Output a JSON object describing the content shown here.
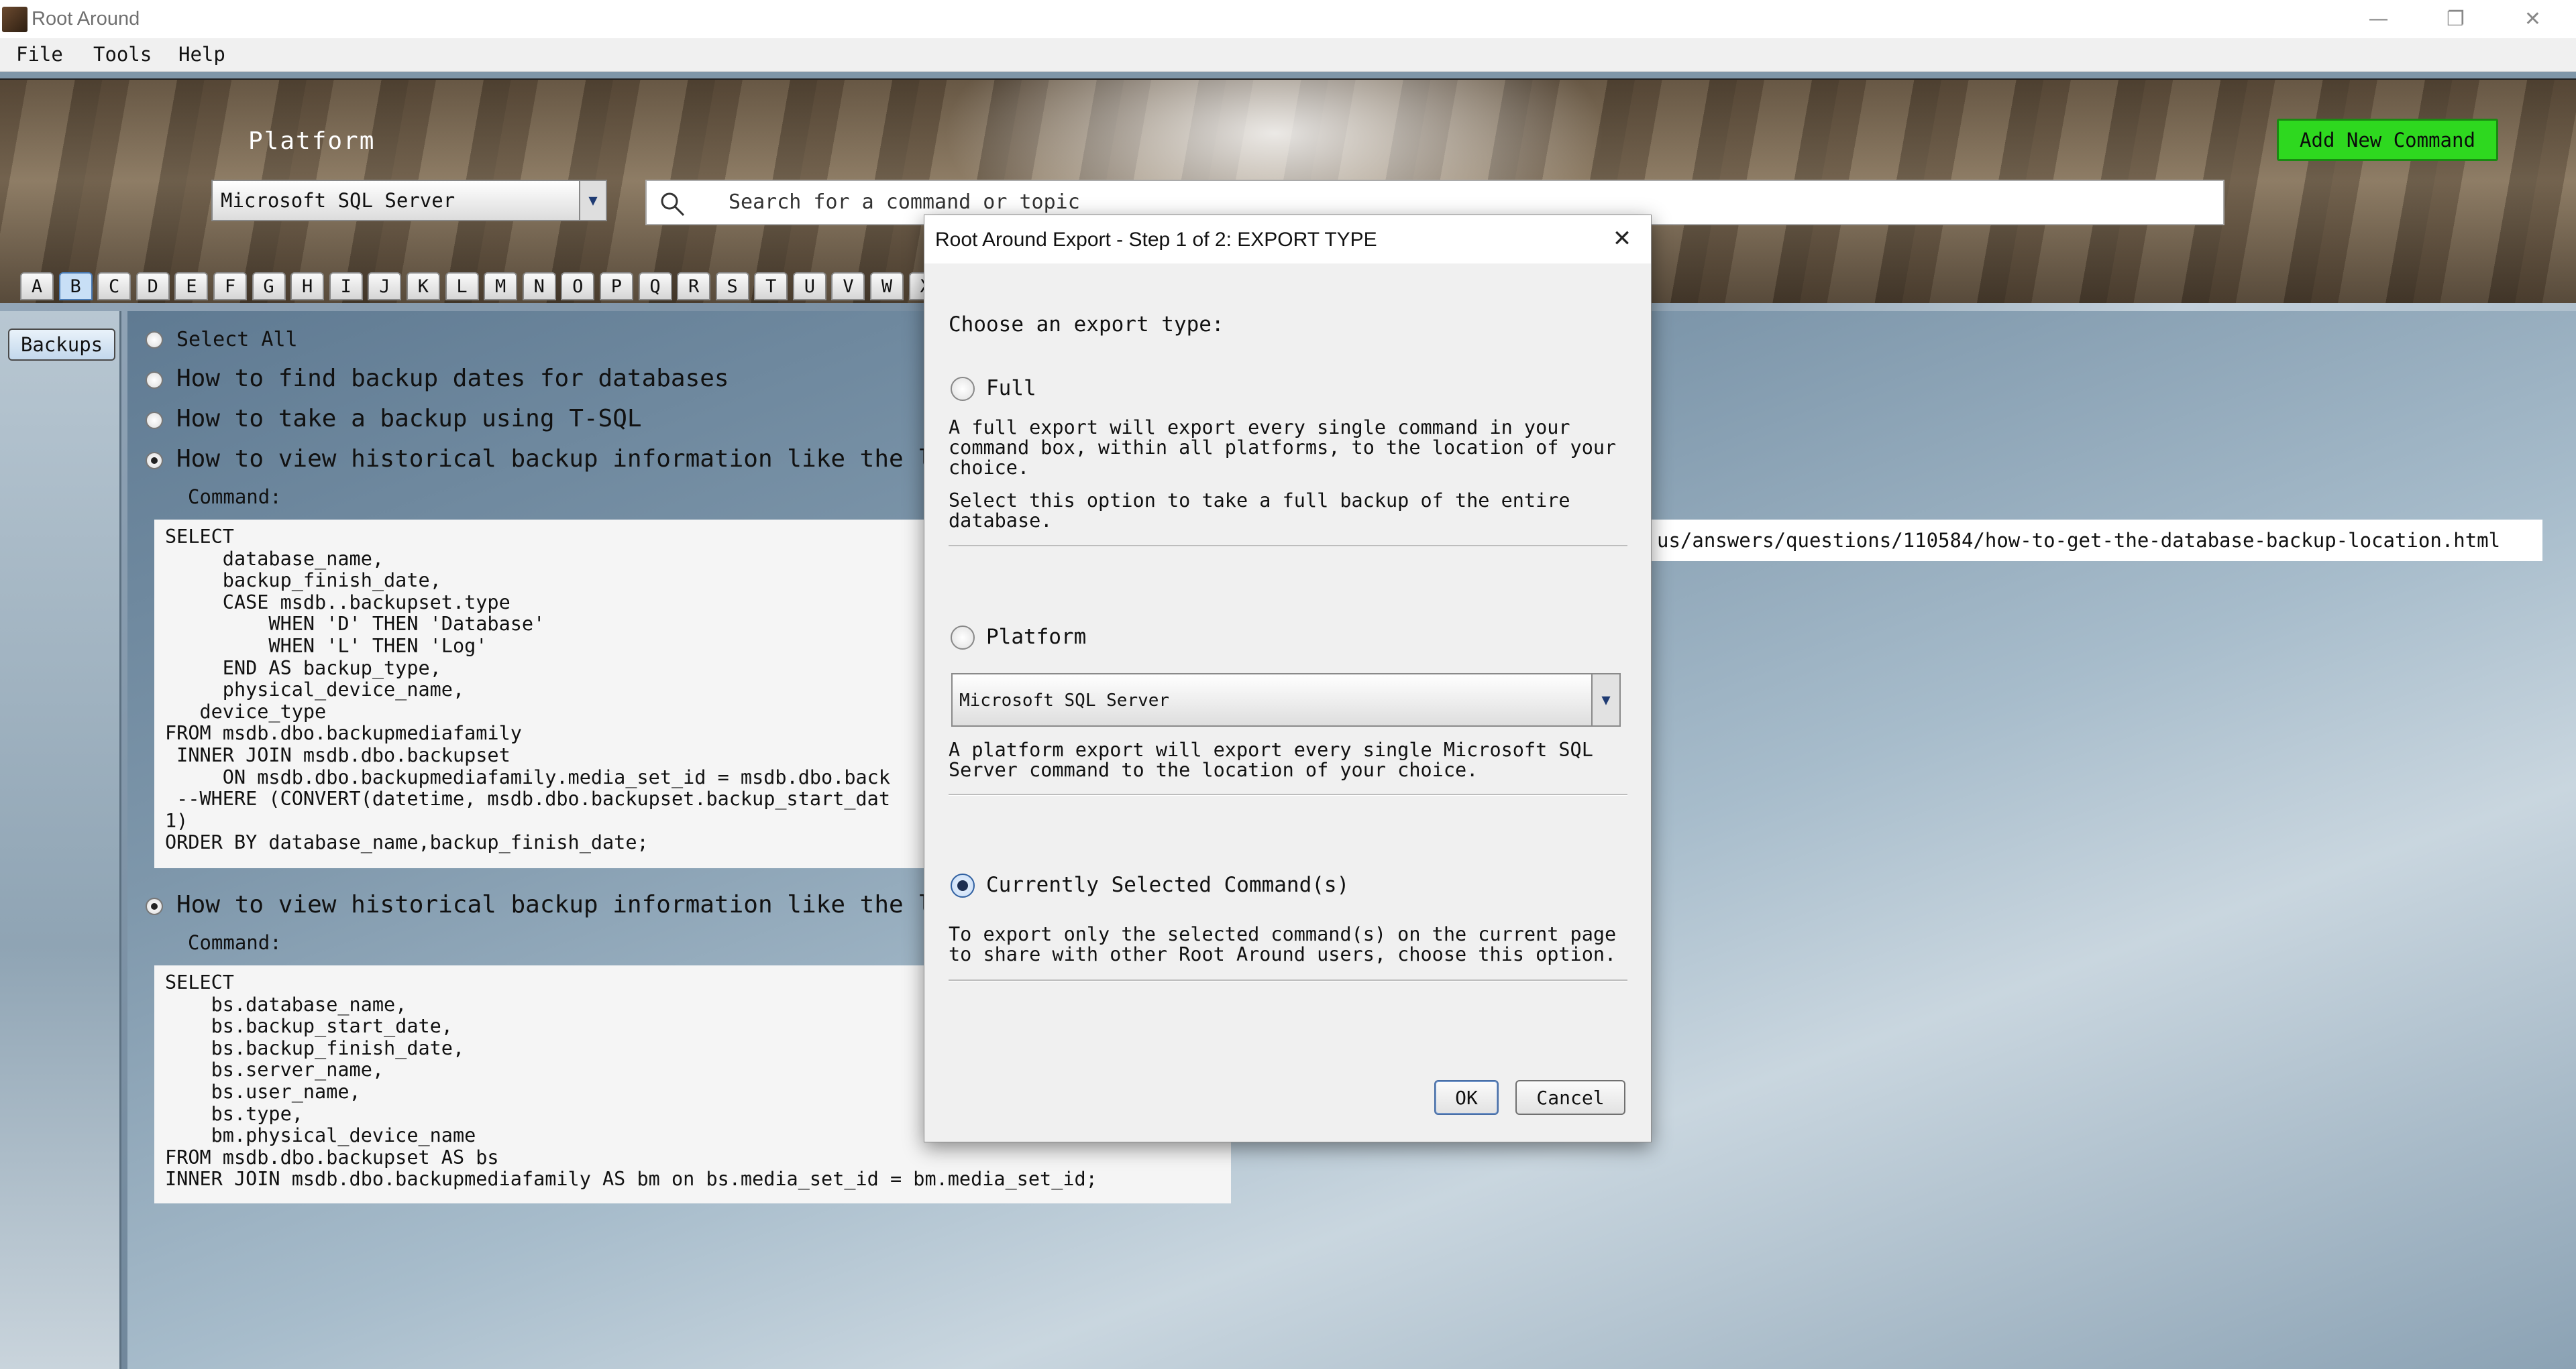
{
  "window": {
    "title": "Root Around",
    "controls": [
      "—",
      "❐",
      "✕"
    ]
  },
  "menu": [
    "File",
    "Tools",
    "Help"
  ],
  "header": {
    "platform_heading": "Platform",
    "platform_value": "Microsoft SQL Server",
    "search_placeholder": "Search for a command or topic",
    "add_button": "Add New Command",
    "accent_color": "#2ed81f"
  },
  "letters": [
    "A",
    "B",
    "C",
    "D",
    "E",
    "F",
    "G",
    "H",
    "I",
    "J",
    "K",
    "L",
    "M",
    "N",
    "O",
    "P",
    "Q",
    "R",
    "S",
    "T",
    "U",
    "V",
    "W",
    "X"
  ],
  "active_letter": "B",
  "sidebar": {
    "tab_label": "Backups"
  },
  "commands": {
    "select_all": "Select All",
    "items": [
      {
        "title": "How to find backup dates for databases",
        "selected": false
      },
      {
        "title": "How to take a backup using T-SQL",
        "selected": false
      },
      {
        "title": "How to view historical backup information like the lo",
        "selected": true
      },
      {
        "title": "How to view historical backup information like the lo",
        "selected": true
      }
    ],
    "command_label": "Command:",
    "code1": [
      "SELECT",
      "     database_name,",
      "     backup_finish_date,",
      "     CASE msdb..backupset.type",
      "         WHEN 'D' THEN 'Database'",
      "         WHEN 'L' THEN 'Log'",
      "     END AS backup_type,",
      "     physical_device_name,",
      "   device_type",
      "FROM msdb.dbo.backupmediafamily",
      " INNER JOIN msdb.dbo.backupset",
      "     ON msdb.dbo.backupmediafamily.media_set_id = msdb.dbo.back",
      " --WHERE (CONVERT(datetime, msdb.dbo.backupset.backup_start_dat",
      "1)",
      "ORDER BY database_name,backup_finish_date;"
    ],
    "url_text": "us/answers/questions/110584/how-to-get-the-database-backup-location.html",
    "code2": [
      "SELECT",
      "    bs.database_name,",
      "    bs.backup_start_date,",
      "    bs.backup_finish_date,",
      "    bs.server_name,",
      "    bs.user_name,",
      "    bs.type,",
      "    bm.physical_device_name",
      "FROM msdb.dbo.backupset AS bs",
      "INNER JOIN msdb.dbo.backupmediafamily AS bm on bs.media_set_id = bm.media_set_id;"
    ]
  },
  "dialog": {
    "title": "Root Around Export - Step 1 of 2: EXPORT TYPE",
    "close": "✕",
    "prompt": "Choose an export type:",
    "full": {
      "label": "Full",
      "desc1": "A full export will export every single command in your\ncommand box, within all platforms, to the location of your\nchoice.",
      "desc2": "Select this option to take a full backup of the entire\ndatabase."
    },
    "platform": {
      "label": "Platform",
      "select_value": "Microsoft SQL Server",
      "desc": "A platform export will export every single Microsoft SQL\nServer command to the location of your choice."
    },
    "current": {
      "label": "Currently Selected Command(s)",
      "desc": "To export only the selected command(s) on the current page\nto share with other Root Around users, choose this option.",
      "selected": true
    },
    "ok": "OK",
    "cancel": "Cancel"
  }
}
